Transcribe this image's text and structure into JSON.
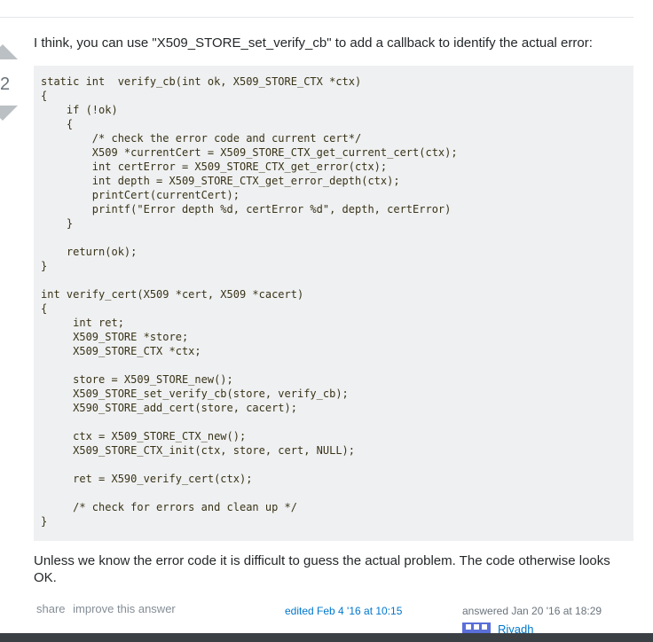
{
  "vote": {
    "count": "2"
  },
  "answer": {
    "intro": "I think, you can use \"X509_STORE_set_verify_cb\" to add a callback to identify the actual error:",
    "code_lines": [
      "static int  verify_cb(int ok, X509_STORE_CTX *ctx)",
      "{",
      "    if (!ok)",
      "    {",
      "        /* check the error code and current cert*/",
      "        X509 *currentCert = X509_STORE_CTX_get_current_cert(ctx);",
      "        int certError = X509_STORE_CTX_get_error(ctx);",
      "        int depth = X509_STORE_CTX_get_error_depth(ctx);",
      "        printCert(currentCert);",
      "        printf(\"Error depth %d, certError %d\", depth, certError)",
      "    }",
      "",
      "    return(ok);",
      "}",
      "",
      "int verify_cert(X509 *cert, X509 *cacert)",
      "{",
      "     int ret;",
      "     X509_STORE *store;",
      "     X509_STORE_CTX *ctx;",
      "",
      "     store = X509_STORE_new();",
      "     X509_STORE_set_verify_cb(store, verify_cb);",
      "     X590_STORE_add_cert(store, cacert);",
      "",
      "     ctx = X509_STORE_CTX_new();",
      "     X509_STORE_CTX_init(ctx, store, cert, NULL);",
      "",
      "     ret = X590_verify_cert(ctx);",
      "",
      "     /* check for errors and clean up */",
      "}"
    ],
    "outro": "Unless we know the error code it is difficult to guess the actual problem. The code otherwise looks OK."
  },
  "post_menu": {
    "share": "share",
    "improve": "improve this answer"
  },
  "edited": "edited Feb 4 '16 at 10:15",
  "answered": "answered Jan 20 '16 at 18:29",
  "user": {
    "name": "Riyadh"
  }
}
